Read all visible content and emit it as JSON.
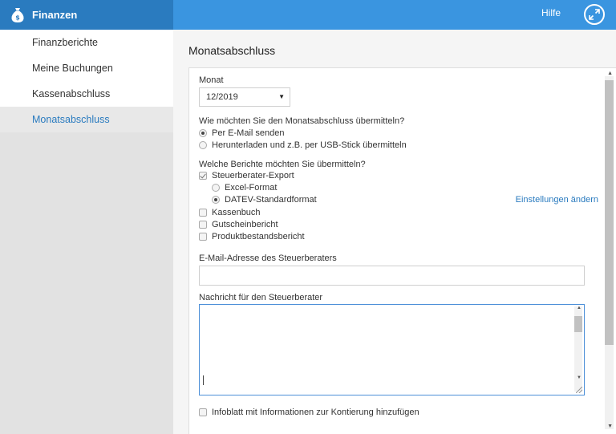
{
  "app": {
    "title": "Finanzen",
    "icon": "money-bag-icon"
  },
  "colors": {
    "brand": "#2a7bbf",
    "topbar": "#3a95e0",
    "link": "#2a7bbf"
  },
  "sidebar": {
    "items": [
      {
        "label": "Finanzberichte",
        "active": false
      },
      {
        "label": "Meine Buchungen",
        "active": false
      },
      {
        "label": "Kassenabschluss",
        "active": false
      },
      {
        "label": "Monatsabschluss",
        "active": true
      }
    ]
  },
  "topbar": {
    "help_label": "Hilfe",
    "expand_icon": "expand-arrows-icon"
  },
  "page": {
    "title": "Monatsabschluss"
  },
  "form": {
    "month_label": "Monat",
    "month_value": "12/2019",
    "transfer_question": "Wie möchten Sie den Monatsabschluss übermitteln?",
    "transfer_options": [
      {
        "label": "Per E-Mail senden",
        "selected": true
      },
      {
        "label": "Herunterladen und z.B. per USB-Stick übermitteln",
        "selected": false
      }
    ],
    "reports_question": "Welche Berichte möchten Sie übermitteln?",
    "reports": {
      "tax_export": {
        "label": "Steuerberater-Export",
        "checked": true
      },
      "format_options": [
        {
          "label": "Excel-Format",
          "selected": false
        },
        {
          "label": "DATEV-Standardformat",
          "selected": true
        }
      ],
      "settings_link": "Einstellungen ändern",
      "others": [
        {
          "label": "Kassenbuch",
          "checked": false
        },
        {
          "label": "Gutscheinbericht",
          "checked": false
        },
        {
          "label": "Produktbestandsbericht",
          "checked": false
        }
      ]
    },
    "email_label": "E-Mail-Adresse des Steuerberaters",
    "email_value": "",
    "message_label": "Nachricht für den Steuerberater",
    "message_value": "",
    "infoblatt": {
      "label": "Infoblatt mit Informationen zur Kontierung hinzufügen",
      "checked": false
    }
  }
}
